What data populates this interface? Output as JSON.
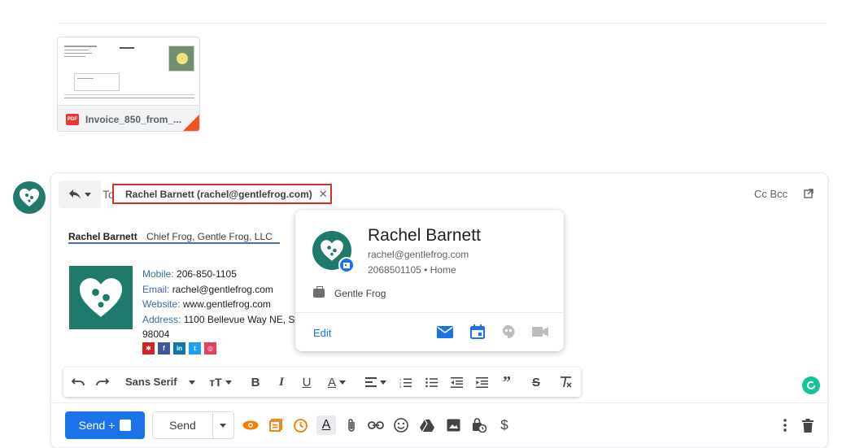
{
  "attachment": {
    "badge": "PDF",
    "filename": "Invoice_850_from_..."
  },
  "compose": {
    "to_label": "To",
    "recipient_chip": "Rachel Barnett (rachel@gentlefrog.com)",
    "chip_remove": "✕",
    "cc_bcc": "Cc Bcc"
  },
  "signature": {
    "name": "Rachel Barnett",
    "title": "Chief Frog, Gentle Frog, LLC",
    "mobile_label": "Mobile:",
    "mobile": "206-850-1105",
    "email_label": "Email:",
    "email": "rachel@gentlefrog.com",
    "website_label": "Website:",
    "website": "www.gentlefrog.com",
    "address_label": "Address:",
    "address": "1100 Bellevue Way NE, Ste",
    "address_zip": "98004",
    "social": [
      {
        "glyph": "yelp",
        "color": "#d32323"
      },
      {
        "glyph": "f",
        "color": "#3b5998"
      },
      {
        "glyph": "in",
        "color": "#0e76a8"
      },
      {
        "glyph": "t",
        "color": "#1da1f2"
      },
      {
        "glyph": "ig",
        "color": "#e4405f"
      }
    ]
  },
  "contact_card": {
    "name": "Rachel Barnett",
    "email": "rachel@gentlefrog.com",
    "phone": "2068501105 • Home",
    "company": "Gentle Frog",
    "edit_label": "Edit"
  },
  "format_toolbar": {
    "font_family": "Sans Serif"
  },
  "actions": {
    "send_plus_label": "Send +",
    "send_label": "Send"
  },
  "colors": {
    "brand_teal": "#1f7a6c",
    "accent_blue": "#1a73e8",
    "highlight_red": "#d93025"
  }
}
